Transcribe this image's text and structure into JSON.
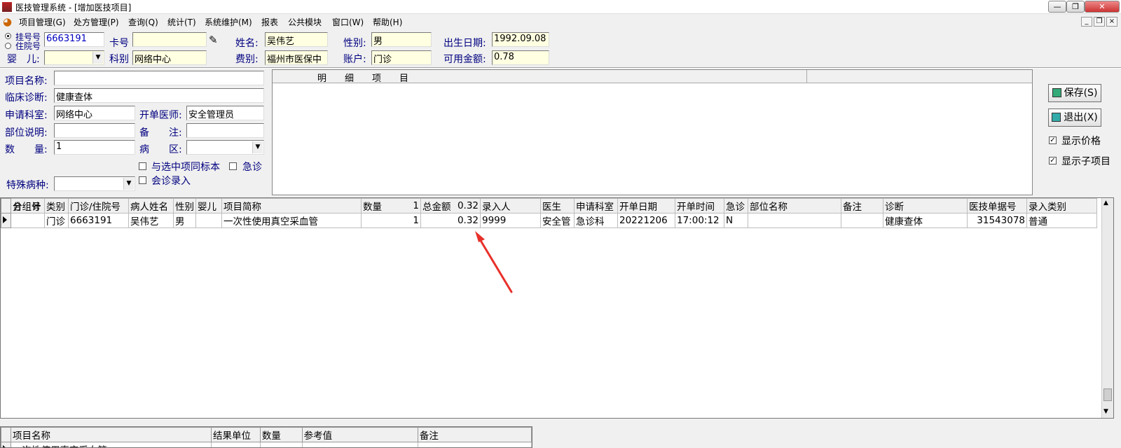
{
  "window": {
    "title": "医技管理系统 - [增加医技项目]"
  },
  "menu": [
    {
      "label": "项目管理(G)"
    },
    {
      "label": "处方管理(P)"
    },
    {
      "label": "查询(Q)"
    },
    {
      "label": "统计(T)"
    },
    {
      "label": "系统维护(M)"
    },
    {
      "label": "报表"
    },
    {
      "label": "公共模块"
    },
    {
      "label": "窗口(W)"
    },
    {
      "label": "帮助(H)"
    }
  ],
  "patient": {
    "radio_register_label": "挂号号",
    "radio_inpatient_label": "住院号",
    "register_no": "6663191",
    "card_label": "卡号",
    "card_value": "",
    "name_label": "姓名:",
    "name_value": "吴伟艺",
    "gender_label": "性别:",
    "gender_value": "男",
    "birth_label": "出生日期:",
    "birth_value": "1992.09.08",
    "infant_label": "婴　儿:",
    "infant_value": "",
    "dept_label": "科别",
    "dept_value": "网络中心",
    "fee_label": "费别:",
    "fee_value": "福州市医保中",
    "account_label": "账户:",
    "account_value": "门诊",
    "balance_label": "可用金额:",
    "balance_value": "0.78"
  },
  "form": {
    "item_name_label": "项目名称:",
    "item_name_value": "",
    "diagnosis_label": "临床诊断:",
    "diagnosis_value": "健康查体",
    "req_dept_label": "申请科室:",
    "req_dept_value": "网络中心",
    "doctor_label": "开单医师:",
    "doctor_value": "安全管理员",
    "part_label": "部位说明:",
    "part_value": "",
    "remark_label": "备　　注:",
    "remark_value": "",
    "qty_label": "数　　量:",
    "qty_value": "1",
    "ward_label": "病　　区:",
    "ward_value": "",
    "same_specimen_label": "与选中项同标本",
    "urgent_label": "急诊",
    "consult_label": "会诊录入",
    "special_label": "特殊病种:",
    "special_value": ""
  },
  "detail": {
    "header": "明　　细　　项　　目"
  },
  "actions": {
    "save_label": "保存(S)",
    "exit_label": "退出(X)",
    "show_price_label": "显示价格",
    "show_price_checked": true,
    "show_sub_label": "显示子项目",
    "show_sub_checked": true
  },
  "grid": {
    "columns": [
      "分组号",
      "类别",
      "门诊/住院号",
      "病人姓名",
      "性别",
      "婴儿",
      "项目简称",
      "数量",
      "总金额",
      "录入人",
      "医生",
      "申请科室",
      "开单日期",
      "开单时间",
      "急诊",
      "部位名称",
      "备注",
      "诊断",
      "医技单据号",
      "录入类别"
    ],
    "rows": [
      [
        "",
        "门诊",
        "6663191",
        "吴伟艺",
        "男",
        "",
        "一次性使用真空采血管",
        "1",
        "0.32",
        "9999",
        "安全管",
        "急诊科",
        "20221206",
        "17:00:12",
        "N",
        "",
        "",
        "健康查体",
        "31543078",
        "普通"
      ]
    ],
    "total_label": "合　计",
    "total_qty": "1",
    "total_amount": "0.32"
  },
  "subgrid": {
    "columns": [
      "项目名称",
      "结果单位",
      "数量",
      "参考值",
      "备注"
    ],
    "rows": [
      [
        "一次性使用真空采血管",
        "",
        "",
        "",
        ""
      ]
    ]
  },
  "colors": {
    "label_blue": "#000080",
    "field_yellow": "#ffffe1",
    "annotation_red": "#e8302a"
  }
}
